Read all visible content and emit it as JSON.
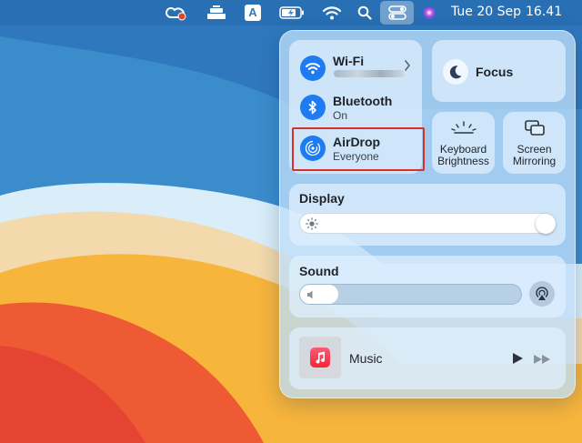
{
  "menubar": {
    "icons": [
      "creative-cloud-icon",
      "keyboard-layout-icon",
      "input-source-icon",
      "battery-icon",
      "wifi-icon",
      "spotlight-icon",
      "control-center-icon",
      "siri-icon"
    ],
    "input_source_letter": "A",
    "date": "Tue 20 Sep",
    "time": "16.41"
  },
  "control_center": {
    "wifi": {
      "title": "Wi-Fi",
      "status": ""
    },
    "bluetooth": {
      "title": "Bluetooth",
      "status": "On"
    },
    "airdrop": {
      "title": "AirDrop",
      "status": "Everyone"
    },
    "focus": {
      "title": "Focus"
    },
    "keyboard_brightness": {
      "line1": "Keyboard",
      "line2": "Brightness"
    },
    "screen_mirroring": {
      "line1": "Screen",
      "line2": "Mirroring"
    },
    "display": {
      "title": "Display",
      "level": 1.0
    },
    "sound": {
      "title": "Sound",
      "level": 0.15
    },
    "music": {
      "title": "Music"
    }
  },
  "colors": {
    "accent": "#1e7bf2",
    "highlight": "#d9302c"
  }
}
